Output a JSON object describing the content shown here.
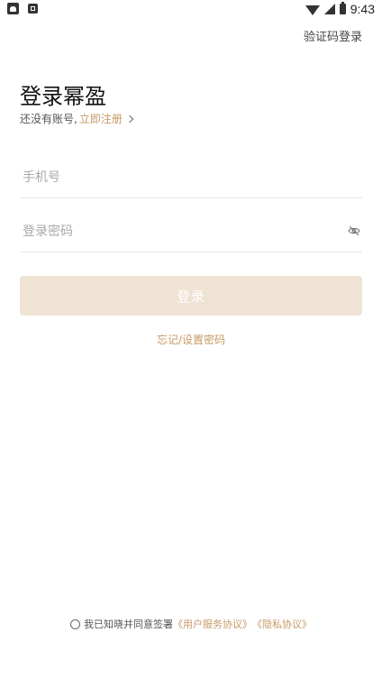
{
  "status_bar": {
    "time": "9:43",
    "icons": [
      "android-icon",
      "notification-icon",
      "wifi-icon",
      "cellular-icon",
      "battery-icon"
    ]
  },
  "header": {
    "sms_login_label": "验证码登录"
  },
  "main": {
    "title": "登录幂盈",
    "no_account_text": "还没有账号,",
    "register_label": "立即注册"
  },
  "form": {
    "phone_placeholder": "手机号",
    "phone_value": "",
    "password_placeholder": "登录密码",
    "password_value": "",
    "login_label": "登录",
    "forgot_label": "忘记/设置密码"
  },
  "agreement": {
    "prefix": "我已知晓并同意签署",
    "user_agreement": "《用户服务协议》",
    "privacy_agreement": "《隐私协议》"
  },
  "colors": {
    "accent": "#c79a66",
    "button_bg": "#efe3d4"
  }
}
